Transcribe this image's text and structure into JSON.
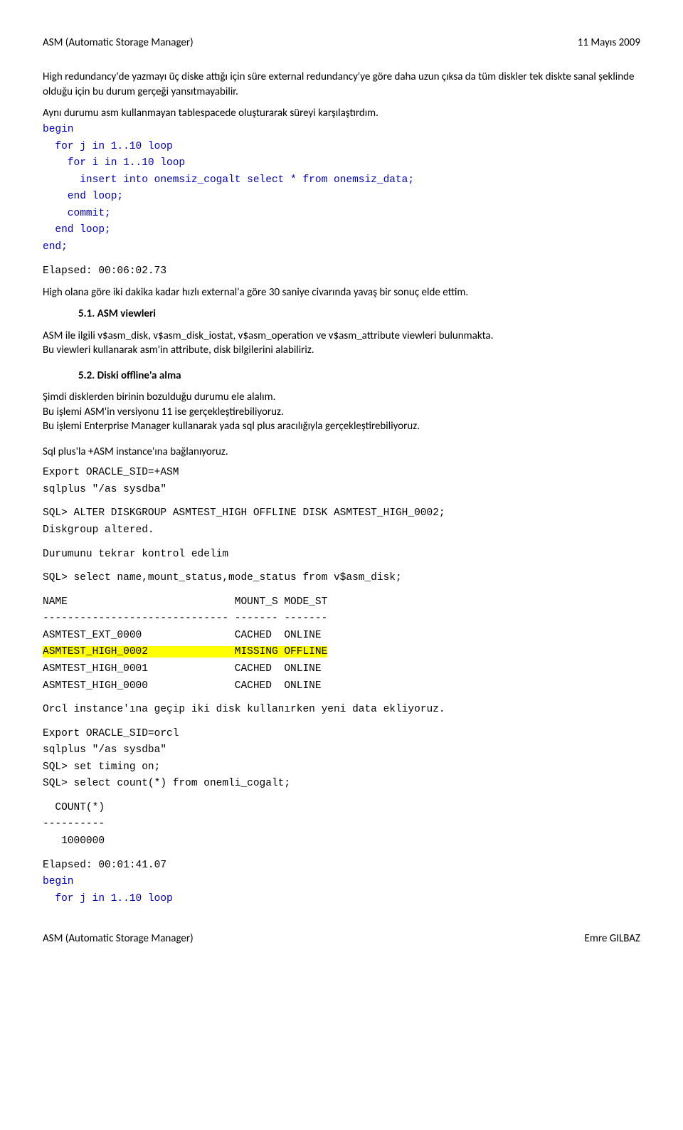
{
  "header": {
    "title": "ASM (Automatic Storage Manager)",
    "date": "11 Mayıs 2009"
  },
  "para1": "High redundancy'de yazmayı üç diske attığı için süre external redundancy'ye göre daha uzun çıksa da tüm diskler tek diskte sanal şeklinde olduğu için bu durum gerçeği yansıtmayabilir.",
  "para2": "Aynı durumu asm kullanmayan tablespacede oluşturarak süreyi karşılaştırdım.",
  "code1": {
    "l1": "begin",
    "l2": "  for j in 1..10 loop",
    "l3": "    for i in 1..10 loop",
    "l4": "      insert into onemsiz_cogalt select * from onemsiz_data;",
    "l5": "    end loop;",
    "l6": "    commit;",
    "l7": "  end loop;",
    "l8": "end;",
    "l9": "Elapsed: 00:06:02.73"
  },
  "para3": "High olana göre iki dakika kadar hızlı external'a göre 30 saniye civarında yavaş bir sonuç elde ettim.",
  "sec51": {
    "num": "5.1.",
    "title": "ASM viewleri",
    "body1": "ASM ile ilgili v$asm_disk, v$asm_disk_iostat, v$asm_operation ve v$asm_attribute viewleri bulunmakta.",
    "body2": "Bu viewleri kullanarak asm'in attribute, disk bilgilerini alabiliriz."
  },
  "sec52": {
    "num": "5.2.",
    "title": "Diski offline'a alma",
    "body1": "Şimdi disklerden birinin bozulduğu durumu ele alalım.",
    "body2": "Bu işlemi ASM'in versiyonu 11 ise gerçekleştirebiliyoruz.",
    "body3": "Bu işlemi Enterprise Manager kullanarak yada sql plus aracılığıyla gerçekleştirebiliyoruz."
  },
  "para4": "Sql plus'la +ASM instance'ına bağlanıyoruz.",
  "code2": {
    "l1": "Export ORACLE_SID=+ASM",
    "l2": "sqlplus \"/as sysdba\"",
    "l3": "SQL> ALTER DISKGROUP ASMTEST_HIGH OFFLINE DISK ASMTEST_HIGH_0002;",
    "l4": "Diskgroup altered.",
    "l5": "Durumunu tekrar kontrol edelim",
    "l6": "SQL> select name,mount_status,mode_status from v$asm_disk;",
    "l7": "NAME                           MOUNT_S MODE_ST",
    "l8": "------------------------------ ------- -------",
    "l9": "ASMTEST_EXT_0000               CACHED  ONLINE",
    "l10": "ASMTEST_HIGH_0002              MISSING OFFLINE",
    "l11": "ASMTEST_HIGH_0001              CACHED  ONLINE",
    "l12": "ASMTEST_HIGH_0000              CACHED  ONLINE",
    "l13": "Orcl instance'ına geçip iki disk kullanırken yeni data ekliyoruz.",
    "l14": "Export ORACLE_SID=orcl",
    "l15": "sqlplus \"/as sysdba\"",
    "l16": "SQL> set timing on;",
    "l17": "SQL> select count(*) from onemli_cogalt;",
    "l18": "  COUNT(*)",
    "l19": "----------",
    "l20": "   1000000",
    "l21": "Elapsed: 00:01:41.07",
    "l22": "begin",
    "l23": "  for j in 1..10 loop"
  },
  "footer": {
    "left": "ASM (Automatic Storage Manager)",
    "right": "Emre GILBAZ"
  }
}
